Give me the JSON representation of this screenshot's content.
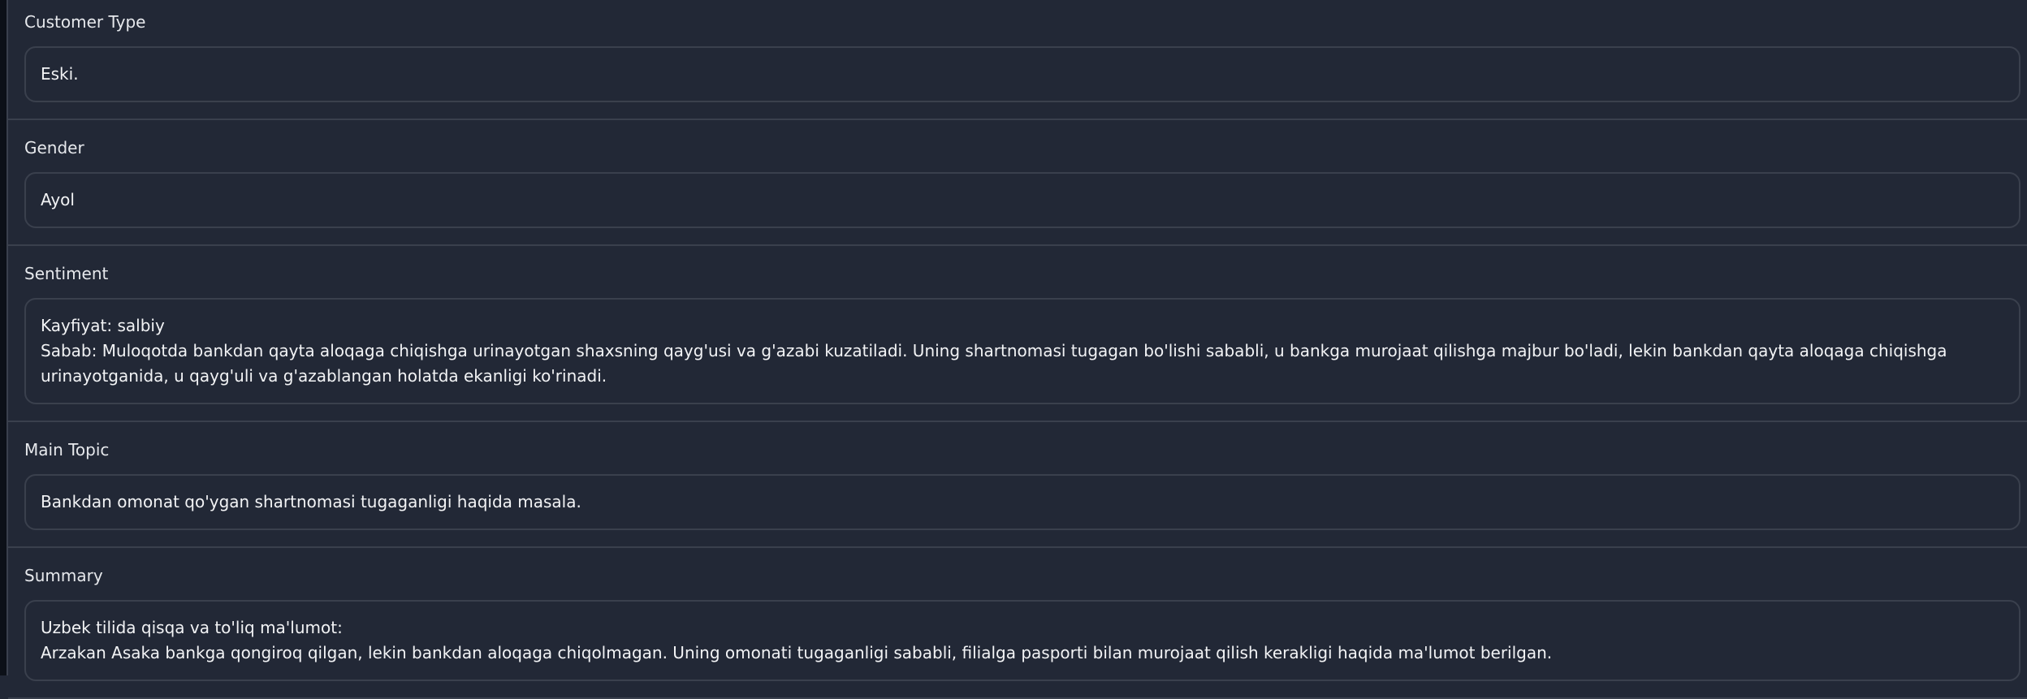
{
  "fields": [
    {
      "label": "Customer Type",
      "value": "Eski."
    },
    {
      "label": "Gender",
      "value": "Ayol"
    },
    {
      "label": "Sentiment",
      "value": "Kayfiyat: salbiy\nSabab: Muloqotda bankdan qayta aloqaga chiqishga urinayotgan shaxsning qayg'usi va g'azabi kuzatiladi. Uning shartnomasi tugagan bo'lishi sababli, u bankga murojaat qilishga majbur bo'ladi, lekin bankdan qayta aloqaga chiqishga urinayotganida, u qayg'uli va g'azablangan holatda ekanligi ko'rinadi."
    },
    {
      "label": "Main Topic",
      "value": "Bankdan omonat qo'ygan shartnomasi tugaganligi haqida masala."
    },
    {
      "label": "Summary",
      "value": "Uzbek tilida qisqa va to'liq ma'lumot:\nArzakan Asaka bankga qongiroq qilgan, lekin bankdan aloqaga chiqolmagan. Uning omonati tugaganligi sababli, filialga pasporti bilan murojaat qilish kerakligi haqida ma'lumot berilgan."
    }
  ]
}
